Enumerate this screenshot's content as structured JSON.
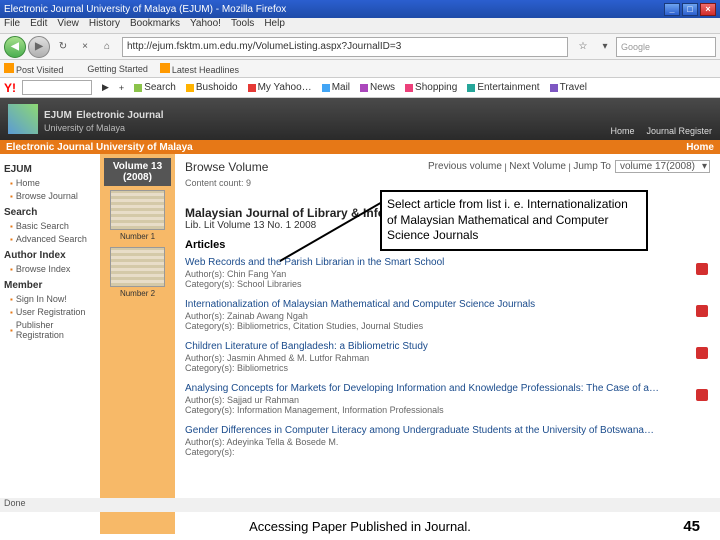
{
  "window": {
    "title": "Electronic Journal University of Malaya (EJUM) - Mozilla Firefox",
    "min": "_",
    "max": "□",
    "close": "×"
  },
  "menu": {
    "items": [
      "File",
      "Edit",
      "View",
      "History",
      "Bookmarks",
      "Yahoo!",
      "Tools",
      "Help"
    ]
  },
  "addr": {
    "back": "◀",
    "fwd": "▶",
    "reload": "↻",
    "stop": "×",
    "url": "http://ejum.fsktm.um.edu.my/VolumeListing.aspx?JournalID=3",
    "star": "☆",
    "search_ph": "Google",
    "down": "▾"
  },
  "bkm": {
    "items": [
      "Post Visited",
      "Getting Started",
      "Latest Headlines"
    ]
  },
  "ytb": {
    "brand": "Y!",
    "go": "▶",
    "plus": "+",
    "links": [
      "Search",
      "Bushoido",
      "My Yahoo…",
      "Mail",
      "News",
      "Shopping",
      "Entertainment",
      "Travel"
    ]
  },
  "ejum": {
    "brand": "EJUM",
    "title": "Electronic Journal",
    "sub": "University of Malaya",
    "hlinks": [
      "Home",
      "Journal Register"
    ]
  },
  "obar": {
    "left": "Electronic Journal University of Malaya",
    "right": "Home"
  },
  "side": {
    "s1": "EJUM",
    "s1a": "Home",
    "s1b": "Browse Journal",
    "s2": "Search",
    "s2a": "Basic Search",
    "s2b": "Advanced Search",
    "s3": "Author Index",
    "s3a": "Browse Index",
    "s4": "Member",
    "s4a": "Sign In Now!",
    "s4b": "User Registration",
    "s4c": "Publisher Registration"
  },
  "mid": {
    "vol_t1": "Volume 13",
    "vol_t2": "(2008)",
    "n1": "Number 1",
    "n2": "Number 2"
  },
  "content": {
    "browse": "Browse Volume",
    "count": "Content count: 9",
    "nav_prev": "Previous volume",
    "nav_next": "Next Volume",
    "jump": "Jump To",
    "sel": "volume 17(2008)",
    "jtitle": "Malaysian Journal of Library & Information Science",
    "jsub": "Lib. Lit   Volume 13 No. 1   2008",
    "art_hd": "Articles",
    "arts": [
      {
        "t": "Web Records and the Parish Librarian in the Smart School",
        "au": "Author(s): Chin Fang Yan",
        "ca": "Category(s): School Libraries"
      },
      {
        "t": "Internationalization of Malaysian Mathematical and Computer Science Journals",
        "au": "Author(s): Zainab Awang Ngah",
        "ca": "Category(s): Bibliometrics, Citation Studies, Journal Studies"
      },
      {
        "t": "Children Literature of Bangladesh: a Bibliometric Study",
        "au": "Author(s): Jasmin Ahmed & M. Lutfor Rahman",
        "ca": "Category(s): Bibliometrics"
      },
      {
        "t": "Analysing Concepts for Markets for Developing Information and Knowledge Professionals: The Case of a…",
        "au": "Author(s): Sajjad ur Rahman",
        "ca": "Category(s): Information Management, Information Professionals"
      },
      {
        "t": "Gender Differences in Computer Literacy among Undergraduate Students at the University of Botswana…",
        "au": "Author(s): Adeyinka Tella & Bosede M.",
        "ca": "Category(s):"
      }
    ]
  },
  "callout": "Select article from list i. e. Internationalization of Malaysian Mathematical and Computer Science Journals",
  "status": "Done",
  "foot": {
    "txt": "Accessing Paper Published in Journal.",
    "pg": "45"
  }
}
